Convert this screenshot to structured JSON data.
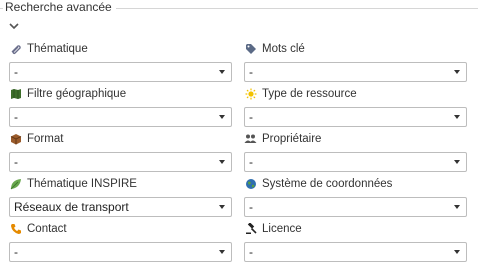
{
  "header": {
    "title": "Recherche avancée"
  },
  "fields": [
    {
      "label": "Thématique",
      "value": "-",
      "icon": "paperclip-icon"
    },
    {
      "label": "Mots clé",
      "value": "-",
      "icon": "tag-icon"
    },
    {
      "label": "Filtre géographique",
      "value": "-",
      "icon": "map-icon"
    },
    {
      "label": "Type de ressource",
      "value": "-",
      "icon": "sun-icon"
    },
    {
      "label": "Format",
      "value": "-",
      "icon": "box-icon"
    },
    {
      "label": "Propriétaire",
      "value": "-",
      "icon": "users-icon"
    },
    {
      "label": "Thématique INSPIRE",
      "value": "Réseaux de transport",
      "icon": "leaf-icon"
    },
    {
      "label": "Système de coordonnées",
      "value": "-",
      "icon": "globe-icon"
    },
    {
      "label": "Contact",
      "value": "-",
      "icon": "phone-icon"
    },
    {
      "label": "Licence",
      "value": "-",
      "icon": "gavel-icon"
    }
  ]
}
